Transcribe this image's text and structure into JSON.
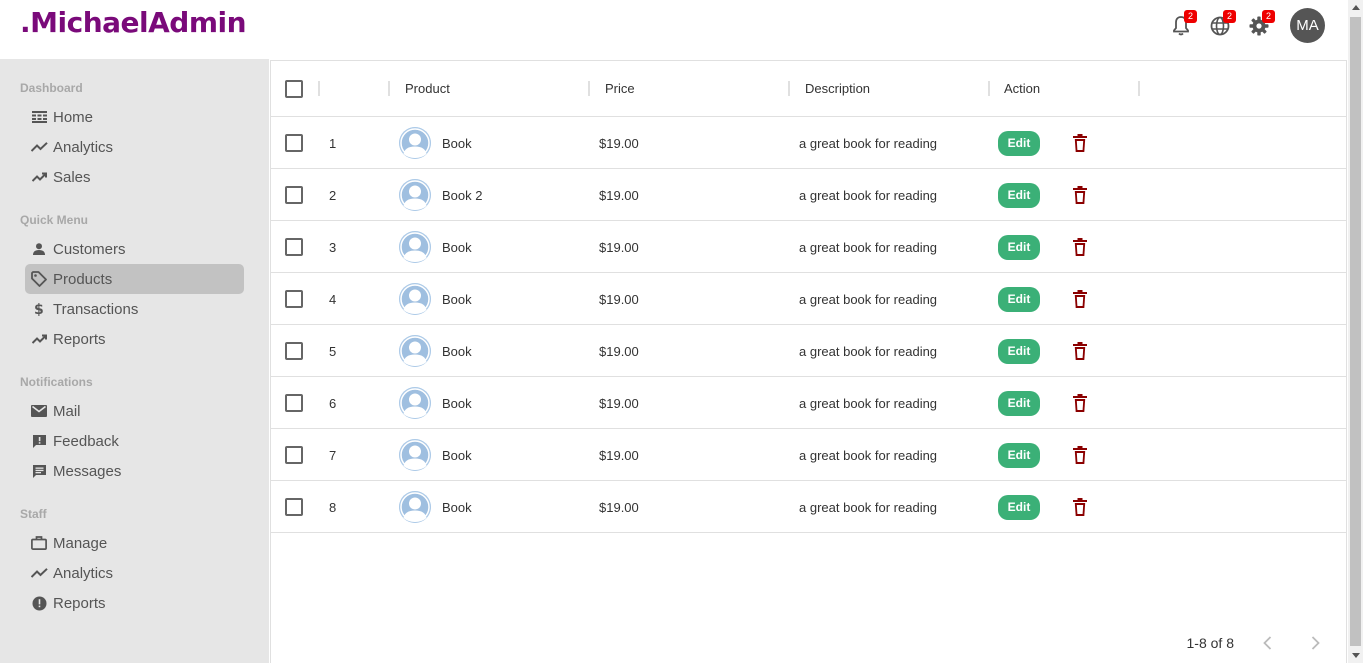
{
  "app": {
    "logo": ".MichaelAdmin"
  },
  "topbar": {
    "notifications_badge": "2",
    "language_badge": "2",
    "settings_badge": "2",
    "avatar_initials": "MA"
  },
  "sidebar": {
    "sections": [
      {
        "title": "Dashboard",
        "items": [
          {
            "label": "Home",
            "icon": "home-icon"
          },
          {
            "label": "Analytics",
            "icon": "trending-icon"
          },
          {
            "label": "Sales",
            "icon": "trending-icon"
          }
        ]
      },
      {
        "title": "Quick Menu",
        "items": [
          {
            "label": "Customers",
            "icon": "person-icon"
          },
          {
            "label": "Products",
            "icon": "tag-icon",
            "active": true
          },
          {
            "label": "Transactions",
            "icon": "dollar-icon"
          },
          {
            "label": "Reports",
            "icon": "trending-icon"
          }
        ]
      },
      {
        "title": "Notifications",
        "items": [
          {
            "label": "Mail",
            "icon": "mail-icon"
          },
          {
            "label": "Feedback",
            "icon": "feedback-icon"
          },
          {
            "label": "Messages",
            "icon": "chat-icon"
          }
        ]
      },
      {
        "title": "Staff",
        "items": [
          {
            "label": "Manage",
            "icon": "briefcase-icon"
          },
          {
            "label": "Analytics",
            "icon": "trending-icon"
          },
          {
            "label": "Reports",
            "icon": "alert-icon"
          }
        ]
      }
    ]
  },
  "table": {
    "columns": {
      "product": "Product",
      "price": "Price",
      "description": "Description",
      "action": "Action"
    },
    "edit_label": "Edit",
    "rows": [
      {
        "id": "1",
        "name": "Book",
        "price": "$19.00",
        "description": "a great book for reading"
      },
      {
        "id": "2",
        "name": "Book 2",
        "price": "$19.00",
        "description": "a great book for reading"
      },
      {
        "id": "3",
        "name": "Book",
        "price": "$19.00",
        "description": "a great book for reading"
      },
      {
        "id": "4",
        "name": "Book",
        "price": "$19.00",
        "description": "a great book for reading"
      },
      {
        "id": "5",
        "name": "Book",
        "price": "$19.00",
        "description": "a great book for reading"
      },
      {
        "id": "6",
        "name": "Book",
        "price": "$19.00",
        "description": "a great book for reading"
      },
      {
        "id": "7",
        "name": "Book",
        "price": "$19.00",
        "description": "a great book for reading"
      },
      {
        "id": "8",
        "name": "Book",
        "price": "$19.00",
        "description": "a great book for reading"
      }
    ]
  },
  "pagination": {
    "summary": "1-8 of 8"
  },
  "colors": {
    "brand": "#7a0a7a",
    "edit": "#3bb077",
    "delete": "#8b0000",
    "badge": "#ee0000",
    "active_item": "#c2c2c2",
    "sidebar_bg": "#e6e6e6"
  }
}
